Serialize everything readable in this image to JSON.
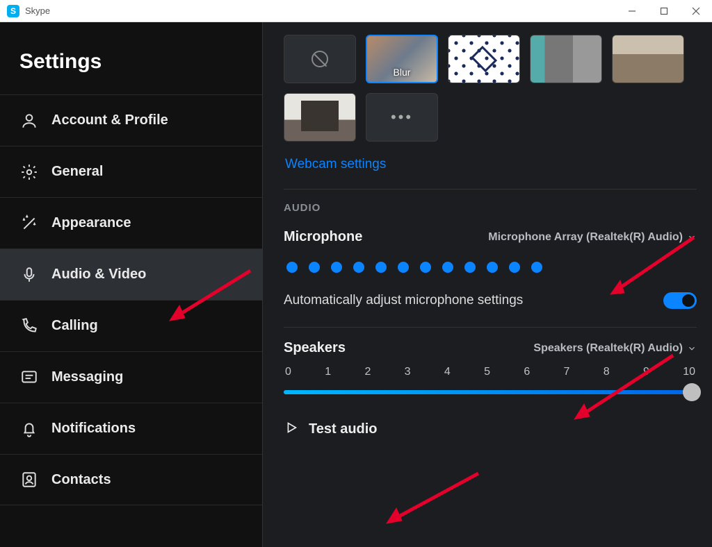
{
  "titlebar": {
    "app_name": "Skype",
    "icon_letter": "S"
  },
  "sidebar": {
    "title": "Settings",
    "items": [
      {
        "label": "Account & Profile",
        "icon": "user"
      },
      {
        "label": "General",
        "icon": "gear"
      },
      {
        "label": "Appearance",
        "icon": "wand"
      },
      {
        "label": "Audio & Video",
        "icon": "mic",
        "active": true
      },
      {
        "label": "Calling",
        "icon": "phone"
      },
      {
        "label": "Messaging",
        "icon": "chat"
      },
      {
        "label": "Notifications",
        "icon": "bell"
      },
      {
        "label": "Contacts",
        "icon": "contacts"
      }
    ]
  },
  "main": {
    "backgrounds": {
      "blur_label": "Blur"
    },
    "webcam_link": "Webcam settings",
    "audio_section": "AUDIO",
    "mic": {
      "label": "Microphone",
      "device": "Microphone Array (Realtek(R) Audio)",
      "level_dots": 12
    },
    "auto_adjust": {
      "label": "Automatically adjust microphone settings",
      "on": true
    },
    "speakers": {
      "label": "Speakers",
      "device": "Speakers (Realtek(R) Audio)",
      "ticks": [
        "0",
        "1",
        "2",
        "3",
        "4",
        "5",
        "6",
        "7",
        "8",
        "9",
        "10"
      ],
      "value": 10
    },
    "test_audio": "Test audio"
  }
}
